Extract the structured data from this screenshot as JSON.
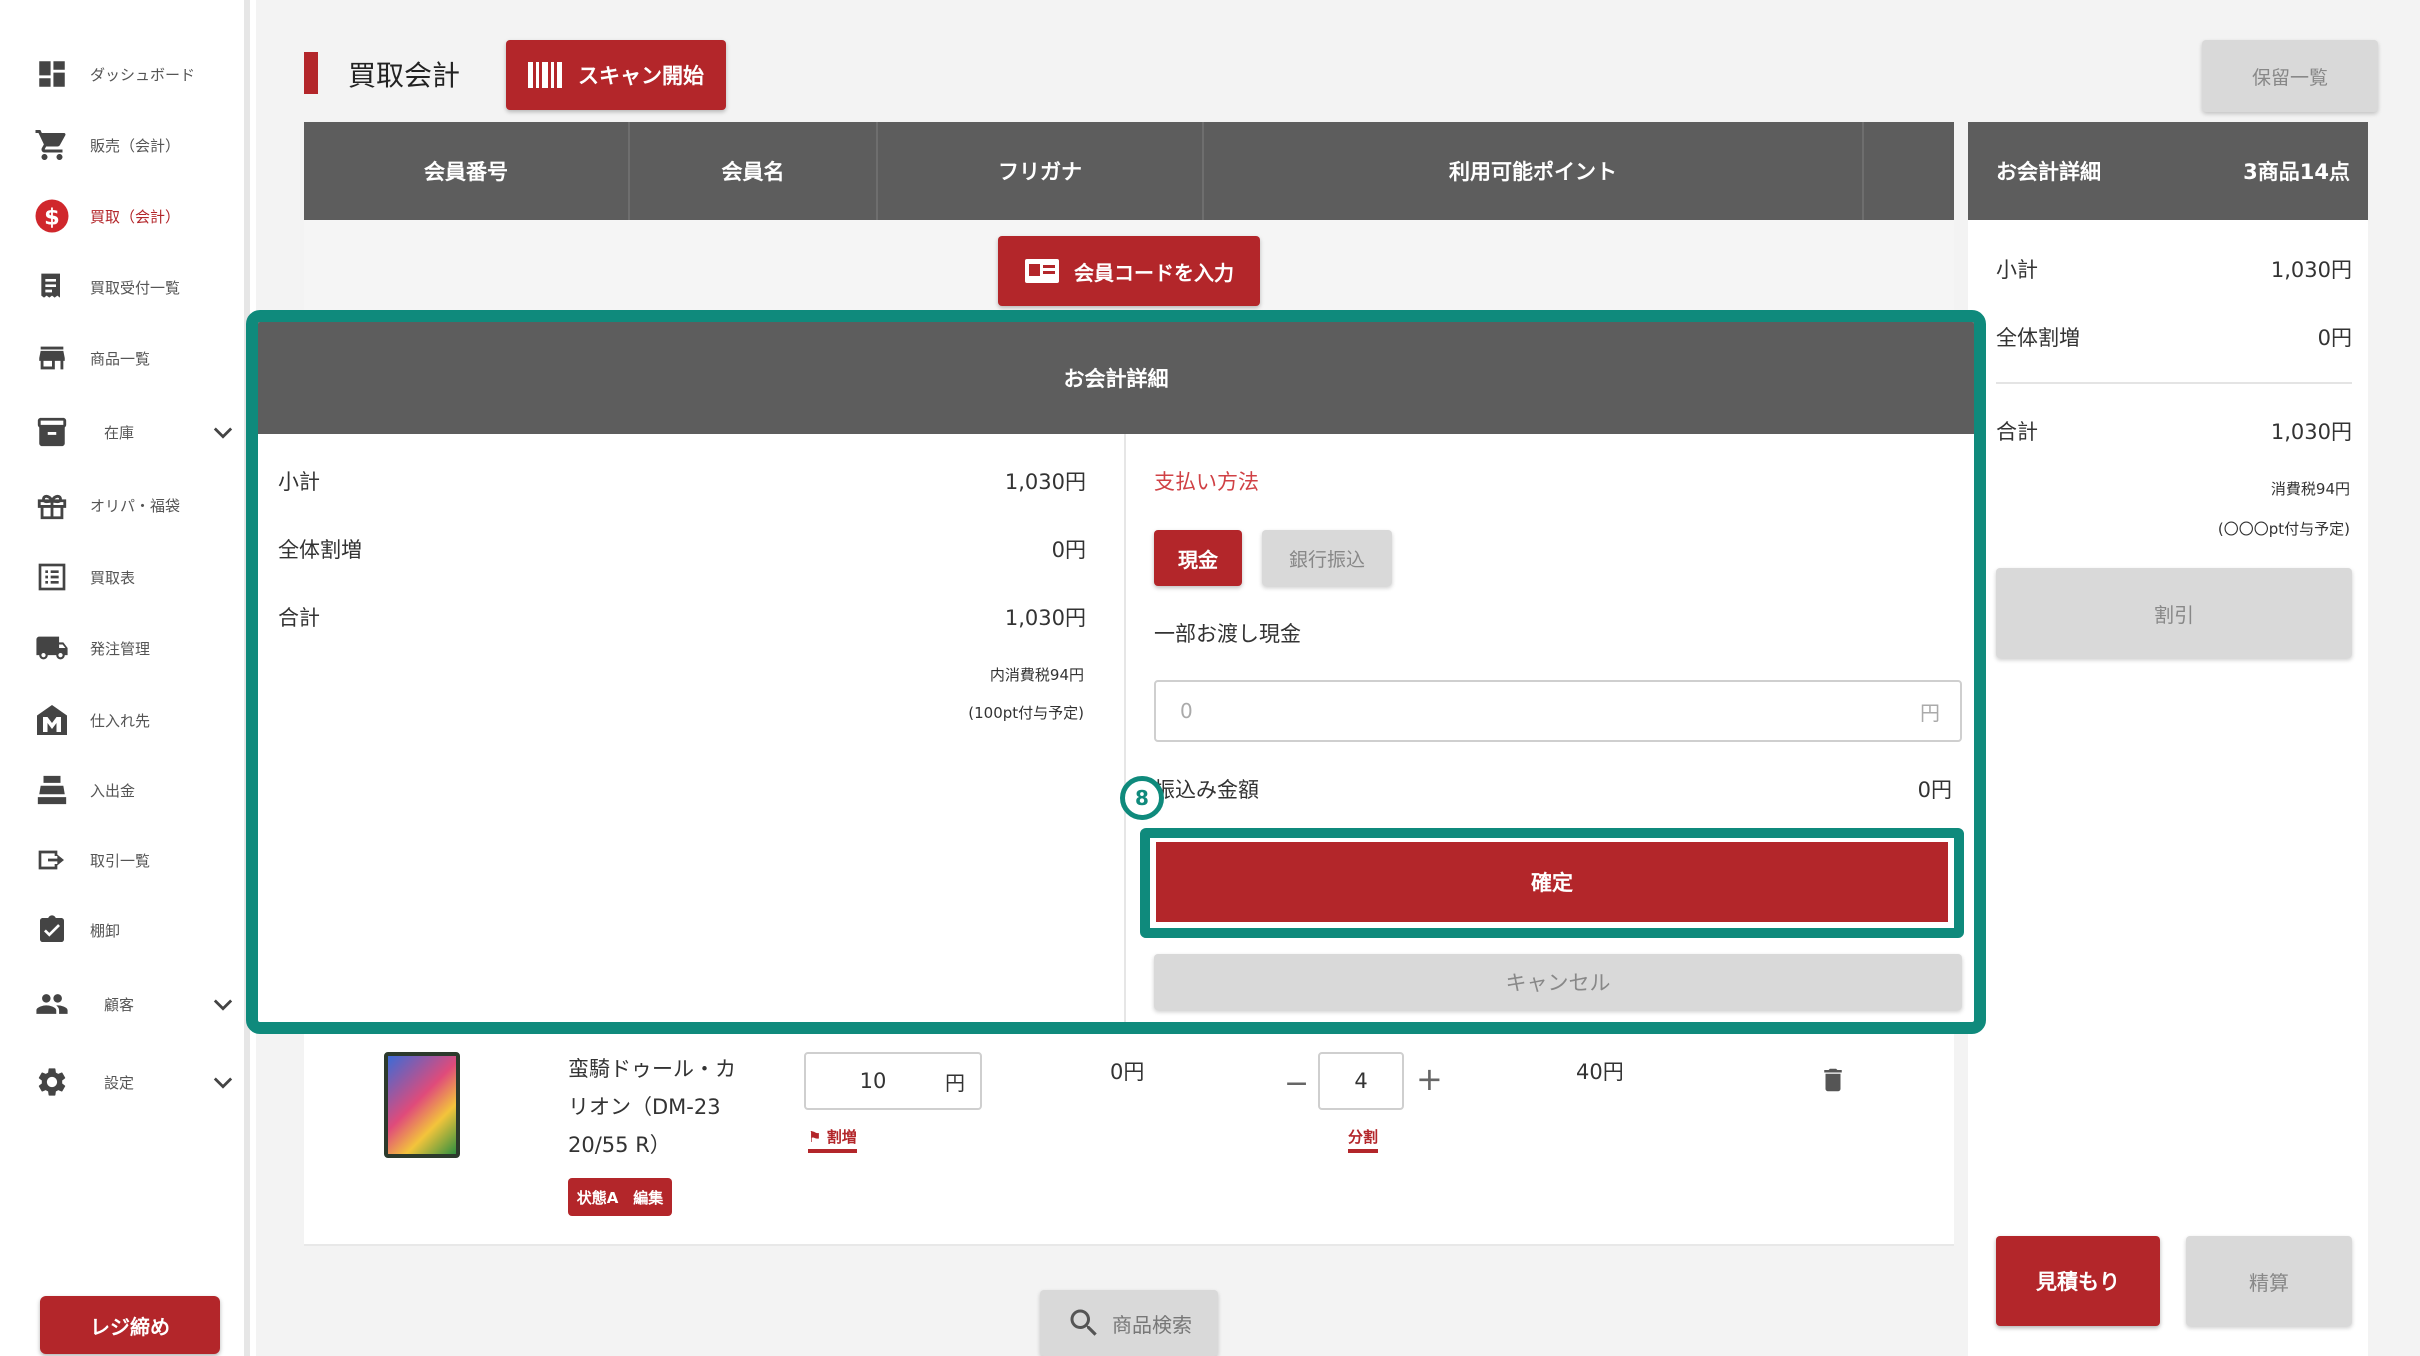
{
  "sidebar": {
    "items": [
      {
        "label": "ダッシュボード",
        "icon": "dashboard-icon"
      },
      {
        "label": "販売（会計）",
        "icon": "cart-icon"
      },
      {
        "label": "買取（会計）",
        "icon": "dollar-icon"
      },
      {
        "label": "買取受付一覧",
        "icon": "receipt-icon"
      },
      {
        "label": "商品一覧",
        "icon": "store-icon"
      },
      {
        "label": "在庫",
        "icon": "inventory-icon"
      },
      {
        "label": "オリパ・福袋",
        "icon": "gift-icon"
      },
      {
        "label": "買取表",
        "icon": "list-icon"
      },
      {
        "label": "発注管理",
        "icon": "truck-icon"
      },
      {
        "label": "仕入れ先",
        "icon": "supplier-icon"
      },
      {
        "label": "入出金",
        "icon": "register-icon"
      },
      {
        "label": "取引一覧",
        "icon": "transaction-icon"
      },
      {
        "label": "棚卸",
        "icon": "checklist-icon"
      },
      {
        "label": "顧客",
        "icon": "people-icon"
      },
      {
        "label": "設定",
        "icon": "gear-icon"
      }
    ],
    "active_index": 2,
    "close_register_label": "レジ締め"
  },
  "header": {
    "title": "買取会計",
    "scan_label": "スキャン開始",
    "hold_list_label": "保留一覧"
  },
  "member_table": {
    "columns": [
      "会員番号",
      "会員名",
      "フリガナ",
      "利用可能ポイント"
    ],
    "enter_code_label": "会員コードを入力"
  },
  "item": {
    "name": "蛮騎ドゥール・カリオン（DM-23 20/55 R）",
    "badge": "状態A　編集",
    "unit_price": "10",
    "unit": "円",
    "price_tag": "割増",
    "discount": "0円",
    "quantity": "4",
    "qty_minus": "−",
    "qty_plus": "+",
    "split_tag": "分割",
    "total": "40円",
    "search_label": "商品検索"
  },
  "summary": {
    "header_label": "お会計詳細",
    "header_count": "3商品14点",
    "subtotal_label": "小計",
    "subtotal_value": "1,030円",
    "discount_label": "全体割増",
    "discount_value": "0円",
    "total_label": "合計",
    "total_value": "1,030円",
    "tax_note": "消費税94円",
    "points_note": "(〇〇〇pt付与予定)",
    "discount_button": "割引",
    "estimate_button": "見積もり",
    "settle_button": "精算"
  },
  "modal": {
    "title": "お会計詳細",
    "subtotal_label": "小計",
    "subtotal_value": "1,030円",
    "discount_label": "全体割増",
    "discount_value": "0円",
    "total_label": "合計",
    "total_value": "1,030円",
    "tax_note": "内消費税94円",
    "points_note": "(100pt付与予定)",
    "payment_method_label": "支払い方法",
    "cash_label": "現金",
    "bank_label": "銀行振込",
    "partial_cash_label": "一部お渡し現金",
    "partial_cash_placeholder": "0",
    "partial_cash_unit": "円",
    "transfer_amount_label": "振込み金額",
    "transfer_amount_value": "0円",
    "confirm_label": "確定",
    "cancel_label": "キャンセル",
    "step_marker": "8"
  },
  "colors": {
    "accent": "#b3262a",
    "highlight": "#0f8a7c",
    "header_gray": "#5d5d5d"
  }
}
